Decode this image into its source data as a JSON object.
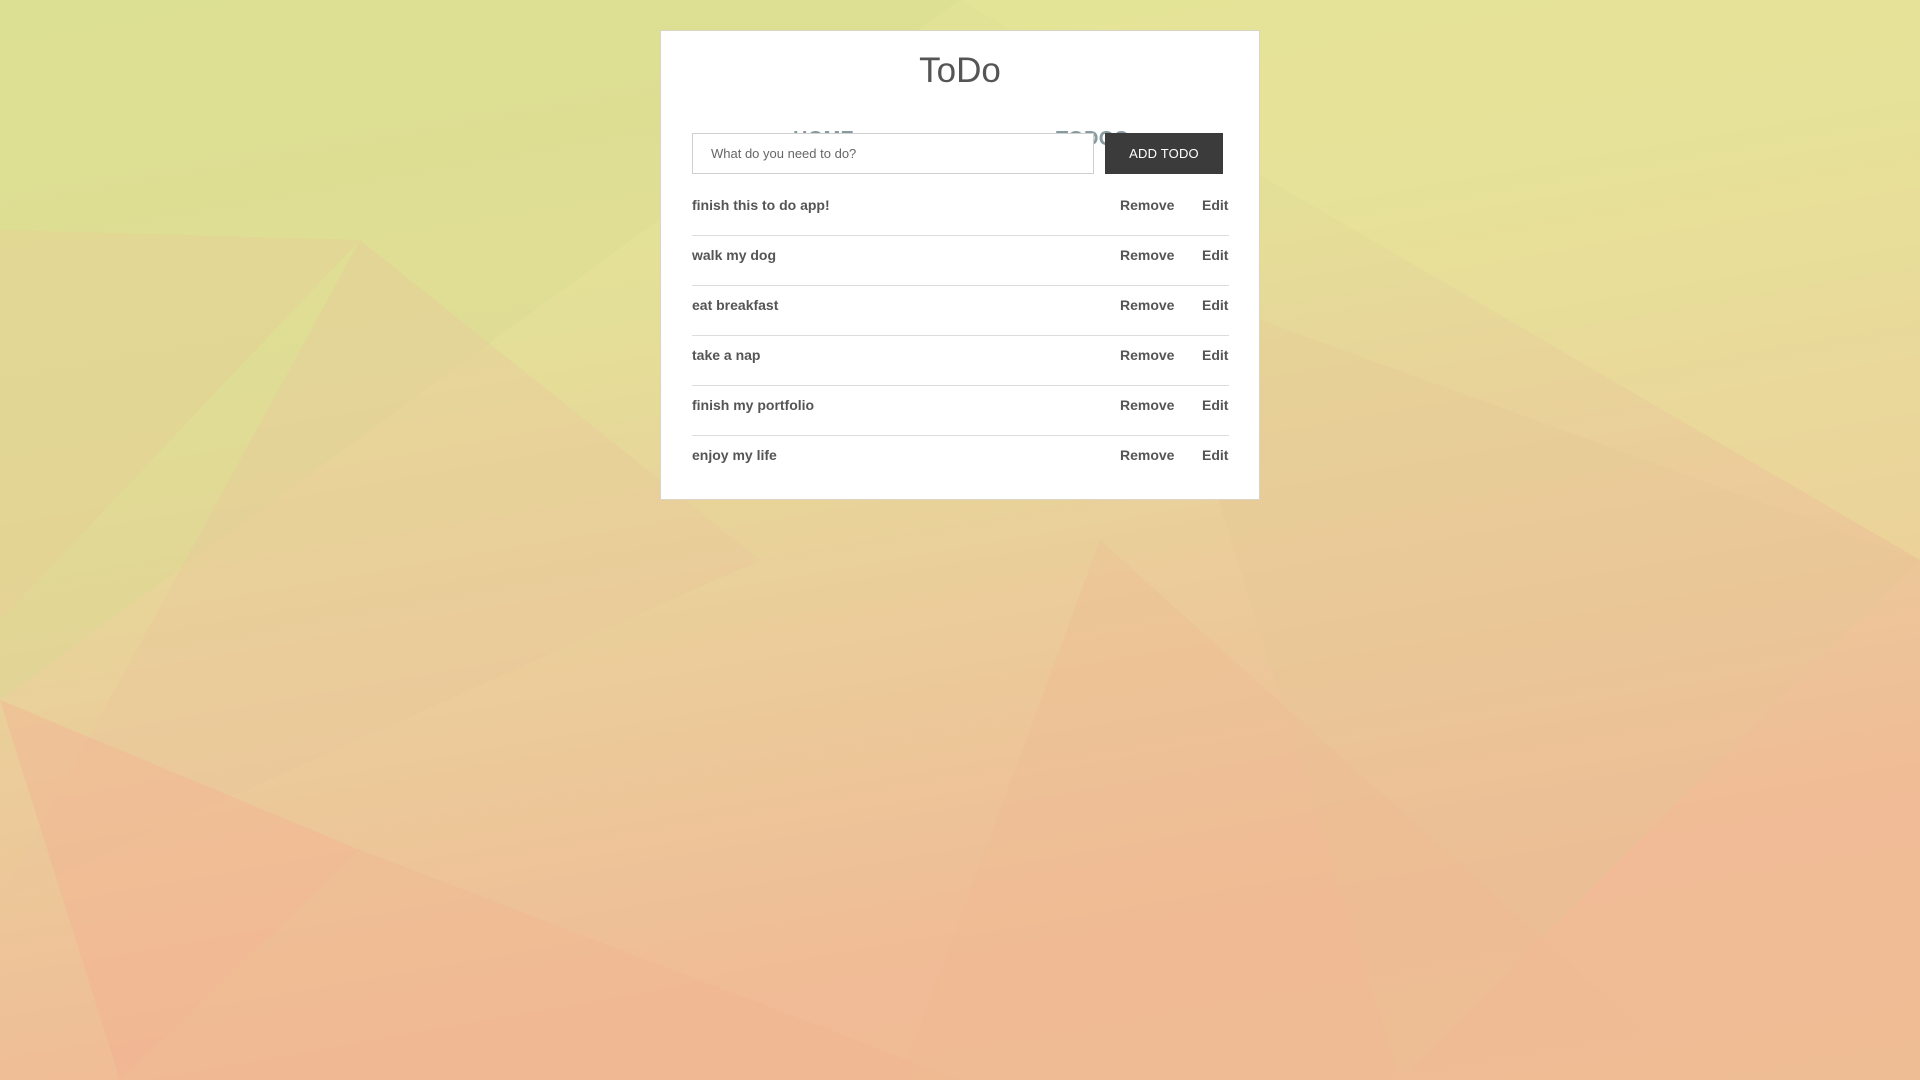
{
  "app": {
    "title": "ToDo"
  },
  "nav": {
    "items": [
      {
        "label": "HOME"
      },
      {
        "label": "TODOS"
      }
    ]
  },
  "form": {
    "placeholder": "What do you need to do?",
    "value": "",
    "add_label": "ADD TODO"
  },
  "todos": [
    {
      "text": "finish this to do app!",
      "remove_label": "Remove",
      "edit_label": "Edit"
    },
    {
      "text": "walk my dog",
      "remove_label": "Remove",
      "edit_label": "Edit"
    },
    {
      "text": "eat breakfast",
      "remove_label": "Remove",
      "edit_label": "Edit"
    },
    {
      "text": "take a nap",
      "remove_label": "Remove",
      "edit_label": "Edit"
    },
    {
      "text": "finish my portfolio",
      "remove_label": "Remove",
      "edit_label": "Edit"
    },
    {
      "text": "enjoy my life",
      "remove_label": "Remove",
      "edit_label": "Edit"
    }
  ],
  "colors": {
    "nav_link": "#869aa0",
    "button_bg": "#3b3b3b",
    "text": "#555555"
  }
}
